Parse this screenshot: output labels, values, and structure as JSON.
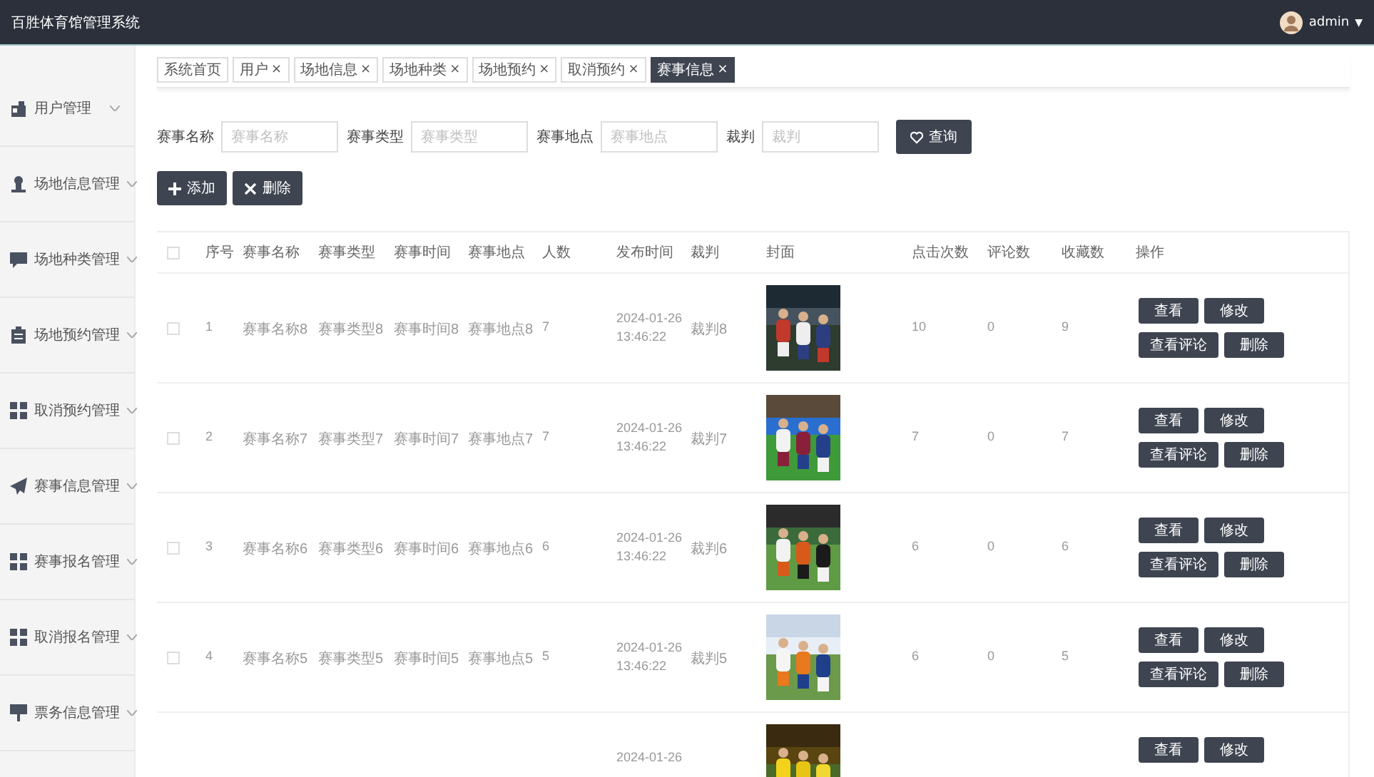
{
  "header": {
    "title": "百胜体育馆管理系统",
    "user": "admin",
    "caret": "▼"
  },
  "sidebar": {
    "items": [
      {
        "label": "用户管理"
      },
      {
        "label": "场地信息管理"
      },
      {
        "label": "场地种类管理"
      },
      {
        "label": "场地预约管理"
      },
      {
        "label": "取消预约管理"
      },
      {
        "label": "赛事信息管理"
      },
      {
        "label": "赛事报名管理"
      },
      {
        "label": "取消报名管理"
      },
      {
        "label": "票务信息管理"
      }
    ]
  },
  "tabs": [
    {
      "label": "系统首页",
      "selected": false
    },
    {
      "label": "用户",
      "close": "×",
      "selected": false
    },
    {
      "label": "场地信息",
      "close": "×",
      "selected": false
    },
    {
      "label": "场地种类",
      "close": "×",
      "selected": false
    },
    {
      "label": "场地预约",
      "close": "×",
      "selected": false
    },
    {
      "label": "取消预约",
      "close": "×",
      "selected": false
    },
    {
      "label": "赛事信息",
      "close": "×",
      "selected": true
    }
  ],
  "search": {
    "fields": [
      {
        "label": "赛事名称",
        "placeholder": "赛事名称"
      },
      {
        "label": "赛事类型",
        "placeholder": "赛事类型"
      },
      {
        "label": "赛事地点",
        "placeholder": "赛事地点"
      },
      {
        "label": "裁判",
        "placeholder": "裁判"
      }
    ],
    "button": "查询"
  },
  "toolbar": {
    "buttons": [
      {
        "kind": "add",
        "label": "添加"
      },
      {
        "kind": "delete",
        "label": "删除"
      }
    ]
  },
  "table": {
    "header_checked": false,
    "columns": [
      "序号",
      "赛事名称",
      "赛事类型",
      "赛事时间",
      "赛事地点",
      "人数",
      "发布时间",
      "裁判",
      "封面",
      "点击次数",
      "评论数",
      "收藏数",
      "操作"
    ],
    "rows": [
      {
        "checked": false,
        "index": "1",
        "name": "赛事名称8",
        "type": "赛事类型8",
        "time": "赛事时间8",
        "place": "赛事地点8",
        "people": "7",
        "published_date": "2024-01-26",
        "published_time": "13:46:22",
        "referee": "裁判8",
        "cover": {
          "kind": "picture"
        },
        "clicks": "10",
        "comments": "0",
        "favorites": "9",
        "actions": [
          "查看",
          "修改",
          "查看评论",
          "删除"
        ]
      },
      {
        "checked": false,
        "index": "2",
        "name": "赛事名称7",
        "type": "赛事类型7",
        "time": "赛事时间7",
        "place": "赛事地点7",
        "people": "7",
        "published_date": "2024-01-26",
        "published_time": "13:46:22",
        "referee": "裁判7",
        "cover": {
          "kind": "picture"
        },
        "clicks": "7",
        "comments": "0",
        "favorites": "7",
        "actions": [
          "查看",
          "修改",
          "查看评论",
          "删除"
        ]
      },
      {
        "checked": false,
        "index": "3",
        "name": "赛事名称6",
        "type": "赛事类型6",
        "time": "赛事时间6",
        "place": "赛事地点6",
        "people": "6",
        "published_date": "2024-01-26",
        "published_time": "13:46:22",
        "referee": "裁判6",
        "cover": {
          "kind": "picture"
        },
        "clicks": "6",
        "comments": "0",
        "favorites": "6",
        "actions": [
          "查看",
          "修改",
          "查看评论",
          "删除"
        ]
      },
      {
        "checked": false,
        "index": "4",
        "name": "赛事名称5",
        "type": "赛事类型5",
        "time": "赛事时间5",
        "place": "赛事地点5",
        "people": "5",
        "published_date": "2024-01-26",
        "published_time": "13:46:22",
        "referee": "裁判5",
        "cover": {
          "kind": "picture"
        },
        "clicks": "6",
        "comments": "0",
        "favorites": "5",
        "actions": [
          "查看",
          "修改",
          "查看评论",
          "删除"
        ]
      },
      {
        "published_date": "2024-01-26",
        "cover": {
          "kind": "picture"
        },
        "actions": [
          "查看",
          "修改"
        ]
      }
    ]
  }
}
